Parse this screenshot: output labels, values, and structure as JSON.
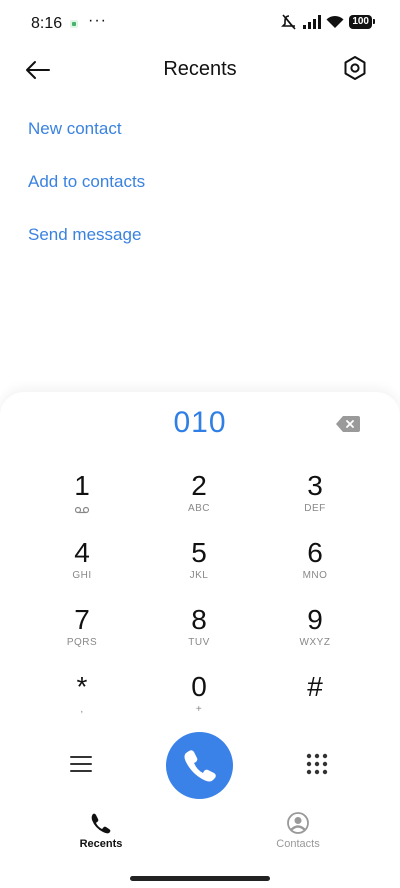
{
  "status_bar": {
    "time": "8:16",
    "more": "···",
    "battery": "100"
  },
  "header": {
    "title": "Recents"
  },
  "actions": [
    {
      "label": "New contact"
    },
    {
      "label": "Add to contacts"
    },
    {
      "label": "Send message"
    }
  ],
  "dialer": {
    "number": "010",
    "keys": [
      {
        "digit": "1",
        "letters": ""
      },
      {
        "digit": "2",
        "letters": "ABC"
      },
      {
        "digit": "3",
        "letters": "DEF"
      },
      {
        "digit": "4",
        "letters": "GHI"
      },
      {
        "digit": "5",
        "letters": "JKL"
      },
      {
        "digit": "6",
        "letters": "MNO"
      },
      {
        "digit": "7",
        "letters": "PQRS"
      },
      {
        "digit": "8",
        "letters": "TUV"
      },
      {
        "digit": "9",
        "letters": "WXYZ"
      },
      {
        "digit": "*",
        "letters": ","
      },
      {
        "digit": "0",
        "letters": "+"
      },
      {
        "digit": "#",
        "letters": ""
      }
    ]
  },
  "tabs": [
    {
      "label": "Recents",
      "icon": "phone-icon",
      "active": true
    },
    {
      "label": "Contacts",
      "icon": "person-icon",
      "active": false
    }
  ],
  "colors": {
    "accent": "#3a82e8",
    "text": "#111111",
    "muted": "#888888"
  }
}
